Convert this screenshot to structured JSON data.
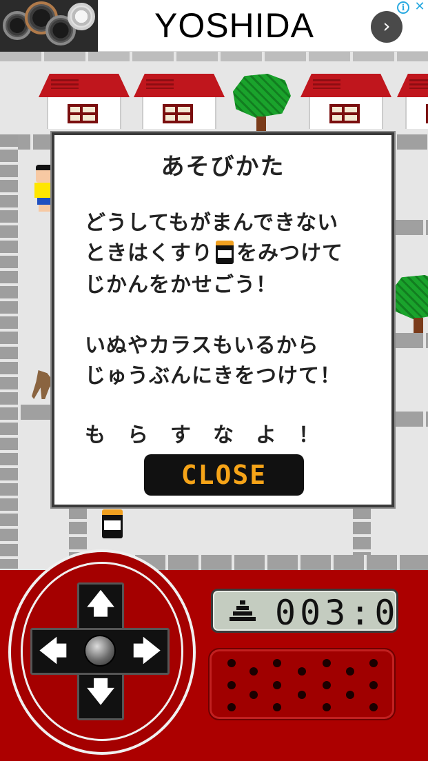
{
  "ad": {
    "brand_text": "YOSHIDA",
    "go_icon": "chevron-right-icon",
    "info_icon": "info-icon",
    "close_icon": "close-icon",
    "info_glyph": "i",
    "close_glyph": "✕",
    "go_glyph": "›"
  },
  "dialog": {
    "title": "あそびかた",
    "lines": [
      "どうしてもがまんできない",
      "ときはくすり",
      "をみつけて",
      "じかんをかせごう！",
      "いぬやカラスもいるから",
      "じゅうぶんにきをつけて！",
      "も　ら　す　な　よ　！"
    ],
    "close_label": "CLOSE"
  },
  "controller": {
    "up_glyph": "🡅",
    "down_glyph": "🡇",
    "left_glyph": "🡄",
    "right_glyph": "🡆",
    "counter_value": "003:0",
    "counter_icon": "poop-icon"
  },
  "colors": {
    "controller_red": "#ac0000",
    "close_text": "#f6a418",
    "roof_red": "#c0161d",
    "tree_green": "#1aa32c"
  }
}
